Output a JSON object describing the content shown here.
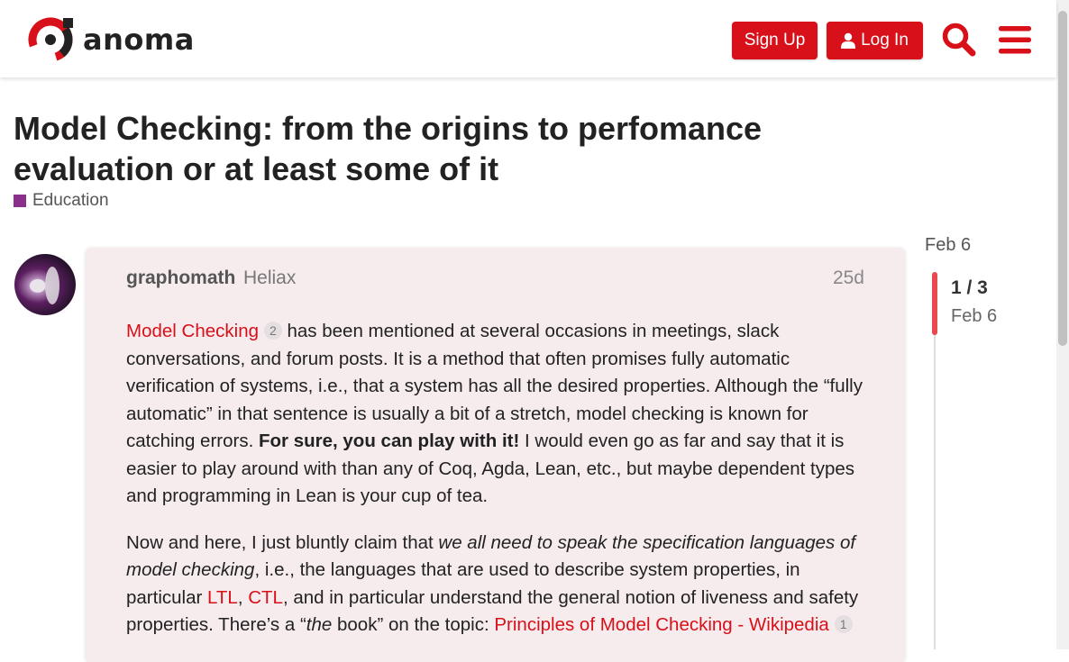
{
  "header": {
    "logo_text": "anoma",
    "signup_label": "Sign Up",
    "login_label": "Log In",
    "search_icon": "search-icon",
    "menu_icon": "hamburger-menu-icon"
  },
  "topic": {
    "title": "Model Checking: from the origins to perfomance evaluation or at least some of it",
    "category": "Education",
    "category_color": "#8c2e8c"
  },
  "post": {
    "username": "graphomath",
    "user_title": "Heliax",
    "date": "25d",
    "p1": {
      "link_model_checking": "Model Checking",
      "link_count": "2",
      "text_a": " has been mentioned at several occasions in meetings, slack conversations, and forum posts. It is a method that often promises fully automatic verification of systems, i.e., that a system has all the desired properties. Although the “fully automatic” in that sentence is usually a bit of a stretch, model checking is known for catching errors. ",
      "bold": "For sure, you can play with it!",
      "text_b": " I would even go as far and say that it is easier to play around with than any of Coq, Agda, Lean, etc., but maybe dependent types and programming in Lean is your cup of tea."
    },
    "p2": {
      "text_a": "Now and here, I just bluntly claim that ",
      "italic_a": "we all need to speak the specification languages of model checking",
      "text_b": ", i.e., the languages that are used to describe system properties, in particular ",
      "link_ltl": "LTL",
      "comma": ", ",
      "link_ctl": "CTL",
      "text_c": ", and in particular understand the general notion of liveness and safety properties. There’s a “",
      "italic_b": "the",
      "text_d": " book” on the topic: ",
      "link_book": "Principles of Model Checking - Wikipedia",
      "link_count": "1"
    }
  },
  "timeline": {
    "top_date": "Feb 6",
    "position": "1 / 3",
    "position_fraction": 0.33,
    "date": "Feb 6"
  },
  "colors": {
    "accent": "#d8101a",
    "post_bg": "#f6ecee"
  }
}
